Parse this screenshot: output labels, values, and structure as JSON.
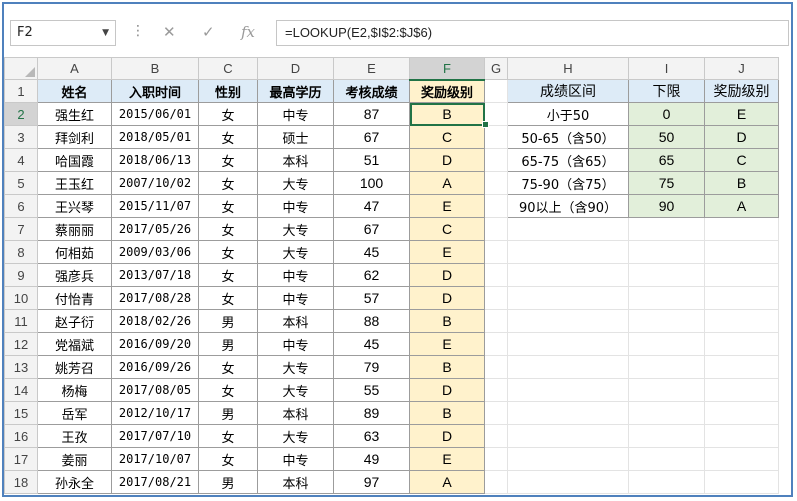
{
  "formula_bar": {
    "name_box": "F2",
    "formula": "=LOOKUP(E2,$I$2:$J$6)",
    "cancel_icon": "✕",
    "enter_icon": "✓",
    "fx_icon": "fx"
  },
  "columns": [
    "A",
    "B",
    "C",
    "D",
    "E",
    "F",
    "G",
    "H",
    "I",
    "J"
  ],
  "rows": [
    "1",
    "2",
    "3",
    "4",
    "5",
    "6",
    "7",
    "8",
    "9",
    "10",
    "11",
    "12",
    "13",
    "14",
    "15",
    "16",
    "17",
    "18"
  ],
  "main_table": {
    "headers": [
      "姓名",
      "入职时间",
      "性别",
      "最高学历",
      "考核成绩",
      "奖励级别"
    ],
    "rows": [
      [
        "强生红",
        "2015/06/01",
        "女",
        "中专",
        "87",
        "B"
      ],
      [
        "拜剑利",
        "2018/05/01",
        "女",
        "硕士",
        "67",
        "C"
      ],
      [
        "哈国霞",
        "2018/06/13",
        "女",
        "本科",
        "51",
        "D"
      ],
      [
        "王玉红",
        "2007/10/02",
        "女",
        "大专",
        "100",
        "A"
      ],
      [
        "王兴琴",
        "2015/11/07",
        "女",
        "中专",
        "47",
        "E"
      ],
      [
        "蔡丽丽",
        "2017/05/26",
        "女",
        "大专",
        "67",
        "C"
      ],
      [
        "何相茹",
        "2009/03/06",
        "女",
        "大专",
        "45",
        "E"
      ],
      [
        "强彦兵",
        "2013/07/18",
        "女",
        "中专",
        "62",
        "D"
      ],
      [
        "付怡青",
        "2017/08/28",
        "女",
        "中专",
        "57",
        "D"
      ],
      [
        "赵子衍",
        "2018/02/26",
        "男",
        "本科",
        "88",
        "B"
      ],
      [
        "党福斌",
        "2016/09/20",
        "男",
        "中专",
        "45",
        "E"
      ],
      [
        "姚芳召",
        "2016/09/26",
        "女",
        "大专",
        "79",
        "B"
      ],
      [
        "杨梅",
        "2017/08/05",
        "女",
        "大专",
        "55",
        "D"
      ],
      [
        "岳军",
        "2012/10/17",
        "男",
        "本科",
        "89",
        "B"
      ],
      [
        "王孜",
        "2017/07/10",
        "女",
        "大专",
        "63",
        "D"
      ],
      [
        "姜丽",
        "2017/10/07",
        "女",
        "中专",
        "49",
        "E"
      ],
      [
        "孙永全",
        "2017/08/21",
        "男",
        "本科",
        "97",
        "A"
      ]
    ]
  },
  "lookup_table": {
    "headers": [
      "成绩区间",
      "下限",
      "奖励级别"
    ],
    "rows": [
      [
        "小于50",
        "0",
        "E"
      ],
      [
        "50-65（含50）",
        "50",
        "D"
      ],
      [
        "65-75（含65）",
        "65",
        "C"
      ],
      [
        "75-90（含75）",
        "75",
        "B"
      ],
      [
        "90以上（含90）",
        "90",
        "A"
      ]
    ]
  },
  "colors": {
    "header_blue": "#ddebf7",
    "grade_yellow": "#fff2cc",
    "lookup_green": "#e2efda",
    "excel_green": "#217346",
    "frame_blue": "#4f81bd"
  }
}
